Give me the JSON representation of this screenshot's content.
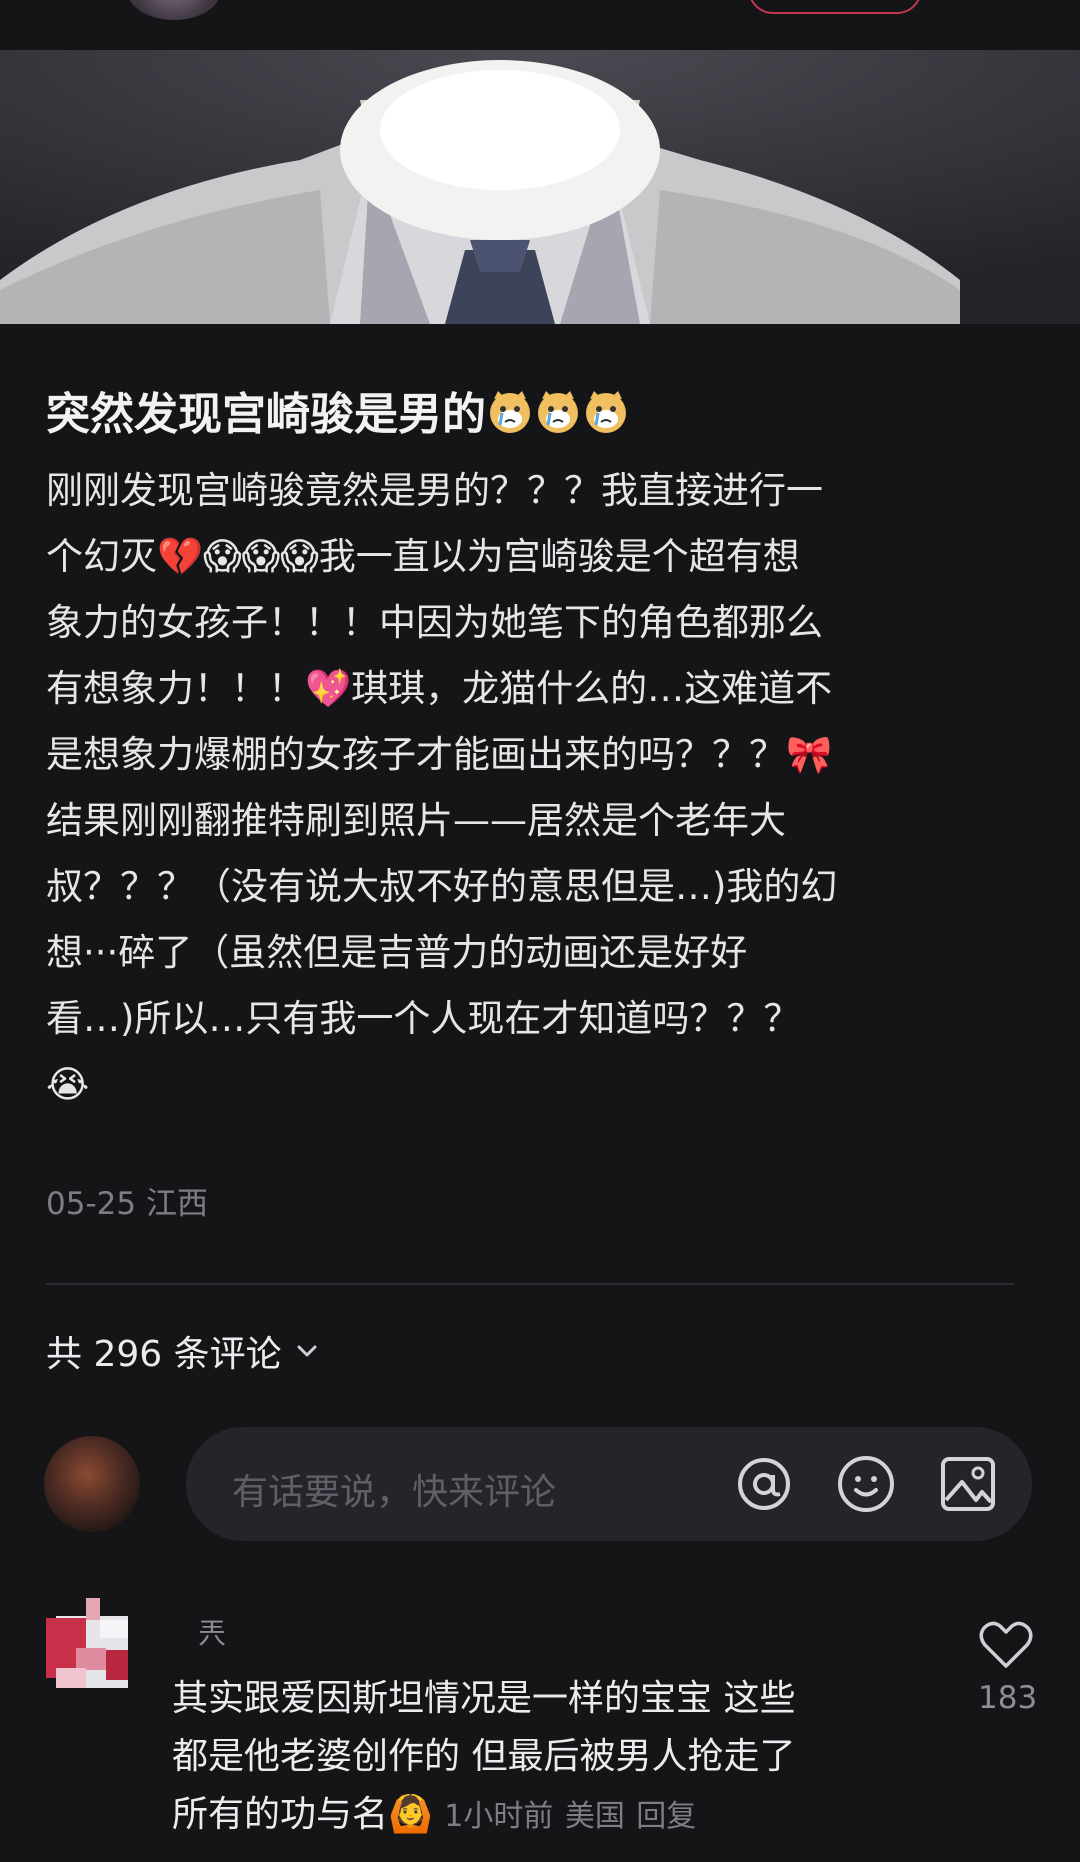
{
  "post": {
    "title": "突然发现宫崎骏是男的",
    "title_emoji": [
      "crying-cat-icon",
      "crying-cat-icon",
      "crying-cat-icon"
    ],
    "body_lines": [
      "刚刚发现宫崎骏竟然是男的？？？我直接进行一",
      "个幻灭💔😱😱😱我一直以为宫崎骏是个超有想",
      "象力的女孩子！！！中因为她笔下的角色都那么",
      "有想象力！！！💖琪琪，龙猫什么的…这难道不",
      "是想象力爆棚的女孩子才能画出来的吗？？？🎀",
      "结果刚刚翻推特刷到照片——居然是个老年大",
      "叔？？？（没有说大叔不好的意思但是…)我的幻",
      "想···碎了（虽然但是吉普力的动画还是好好",
      "看…)所以…只有我一个人现在才知道吗？？？",
      "😭"
    ],
    "date": "05-25",
    "location": "江西"
  },
  "comments_header": {
    "label": "共 296 条评论"
  },
  "comment_input": {
    "placeholder": "有话要说，快来评论",
    "icons": [
      "at-icon",
      "emoji-icon",
      "image-icon"
    ]
  },
  "comments": [
    {
      "author": "兲",
      "text_lines": [
        "其实跟爱因斯坦情况是一样的宝宝 这些",
        "都是他老婆创作的 但最后被男人抢走了",
        "所有的功与名🙆"
      ],
      "time": "1小时前",
      "location": "美国",
      "reply_label": "回复",
      "likes": "183"
    }
  ],
  "colors": {
    "background": "#151518",
    "input_bg": "#24242a",
    "muted_text": "#7d7d86",
    "primary_text": "#ececef"
  }
}
